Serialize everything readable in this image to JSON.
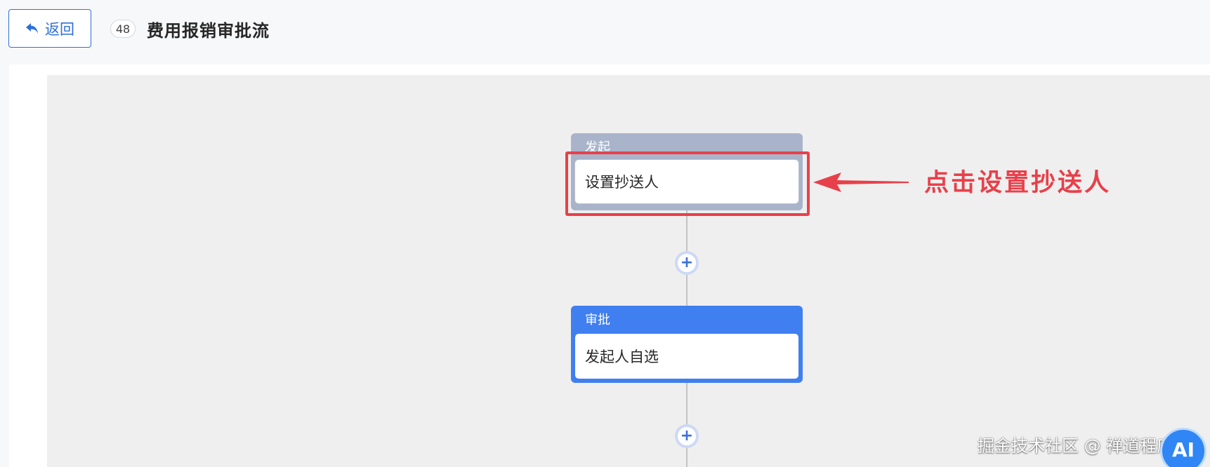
{
  "header": {
    "back_label": "返回",
    "flow_id": "48",
    "title": "费用报销审批流"
  },
  "flow": {
    "start_node": {
      "header": "发起",
      "body": "设置抄送人"
    },
    "approve_node": {
      "header": "审批",
      "body": "发起人自选"
    },
    "add_button_symbol": "+"
  },
  "annotation": {
    "text": "点击设置抄送人",
    "color": "#e8404a"
  },
  "watermark": {
    "text": "掘金技术社区 @ 禅道程序猿",
    "badge": "AI"
  },
  "colors": {
    "accent": "#2e6fd8",
    "approve_node": "#3f7ff0",
    "start_node": "#a9b4cb"
  }
}
